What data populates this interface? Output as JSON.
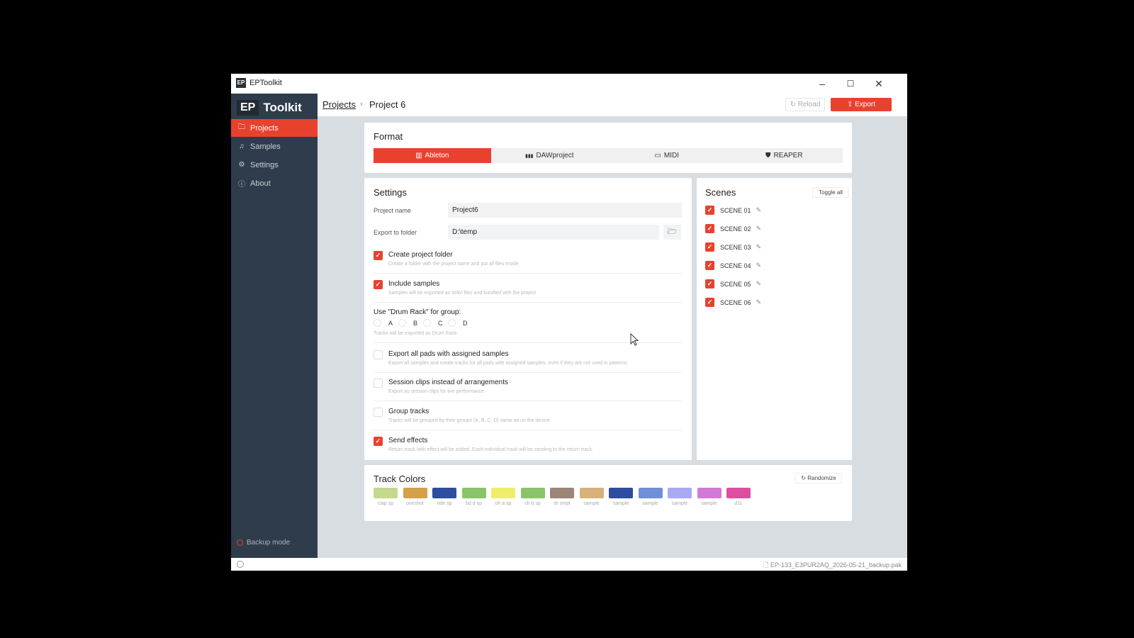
{
  "window": {
    "title": "EPToolkit",
    "icon": "EP",
    "minimize": "–",
    "maximize": "☐",
    "close": "✕"
  },
  "sidebar": {
    "brand_ep": "EP",
    "brand_name": "Toolkit",
    "items": [
      {
        "label": "Projects",
        "icon": "folder-icon",
        "glyph": "🗀"
      },
      {
        "label": "Samples",
        "icon": "music-note-icon",
        "glyph": "♫"
      },
      {
        "label": "Settings",
        "icon": "gear-icon",
        "glyph": "⚙"
      },
      {
        "label": "About",
        "icon": "info-icon",
        "glyph": "ⓘ"
      }
    ],
    "backup_label": "Backup mode"
  },
  "topbar": {
    "crumb_root": "Projects",
    "crumb_sep": "›",
    "crumb_current": "Project 6",
    "reload_label": "↻ Reload",
    "export_label": "⇪ Export"
  },
  "format": {
    "title": "Format",
    "options": [
      {
        "label": "Ableton",
        "glyph": "▥",
        "icon": "ableton-icon"
      },
      {
        "label": "DAWproject",
        "glyph": "▮▮▮",
        "icon": "dawproject-icon"
      },
      {
        "label": "MIDI",
        "glyph": "▭",
        "icon": "midi-icon"
      },
      {
        "label": "REAPER",
        "glyph": "⛊",
        "icon": "reaper-icon"
      }
    ],
    "selected": "Ableton"
  },
  "settings": {
    "title": "Settings",
    "project_name_label": "Project name",
    "project_name_value": "Project6",
    "export_folder_label": "Export to folder",
    "export_folder_value": "D:\\temp",
    "folder_glyph": "🗁",
    "create_folder": {
      "title": "Create project folder",
      "desc": "Create a folder with the project name and put all files inside",
      "checked": true
    },
    "include_samples": {
      "title": "Include samples",
      "desc": "Samples will be exported as WAV files and bundled with the project",
      "checked": true
    },
    "drum_rack_label": "Use \"Drum Rack\" for group:",
    "drum_rack_options": [
      "A",
      "B",
      "C",
      "D"
    ],
    "drum_rack_desc": "Tracks will be exported as Drum Rack",
    "export_all_pads": {
      "title": "Export all pads with assigned samples",
      "desc": "Export all samples and create tracks for all pads with assigned samples, even if they are not used in patterns",
      "checked": false
    },
    "session_clips": {
      "title": "Session clips instead of arrangements",
      "desc": "Export as session clips for live performance",
      "checked": false
    },
    "group_tracks": {
      "title": "Group tracks",
      "desc": "Tracks will be grouped by their groups (A, B, C, D) same as on the device",
      "checked": false
    },
    "send_effects": {
      "title": "Send effects",
      "desc": "Return track with effect will be added. Each individual track will be sending to the return track.",
      "checked": true
    }
  },
  "scenes": {
    "title": "Scenes",
    "toggle_all": "Toggle all",
    "items": [
      "SCENE 01",
      "SCENE 02",
      "SCENE 03",
      "SCENE 04",
      "SCENE 05",
      "SCENE 06"
    ],
    "edit_glyph": "✎",
    "check_glyph": "✓"
  },
  "track_colors": {
    "title": "Track Colors",
    "randomize": "↻ Randomize",
    "swatches": [
      {
        "label": "clap sp",
        "color": "#c4d98c"
      },
      {
        "label": "oneshot",
        "color": "#d4a14a"
      },
      {
        "label": "ride sp",
        "color": "#2f4d9e"
      },
      {
        "label": "bd d sp",
        "color": "#8bc36b"
      },
      {
        "label": "oh a sp",
        "color": "#eeee6a"
      },
      {
        "label": "ch b sp",
        "color": "#8bc36b"
      },
      {
        "label": "dr smpl",
        "color": "#9c8577"
      },
      {
        "label": "sample",
        "color": "#d8b07a"
      },
      {
        "label": "sample",
        "color": "#2f4d9e"
      },
      {
        "label": "sample",
        "color": "#6f8fd6"
      },
      {
        "label": "sample",
        "color": "#a9a9f2"
      },
      {
        "label": "sample",
        "color": "#d07ad6"
      },
      {
        "label": "d11",
        "color": "#dd4f9c"
      }
    ]
  },
  "statusbar": {
    "file": "🗋 EP-133_E3PUR2AQ_2026-05-21_backup.pak"
  },
  "colors": {
    "accent": "#e8422f",
    "sidebar": "#2f3c4b"
  }
}
